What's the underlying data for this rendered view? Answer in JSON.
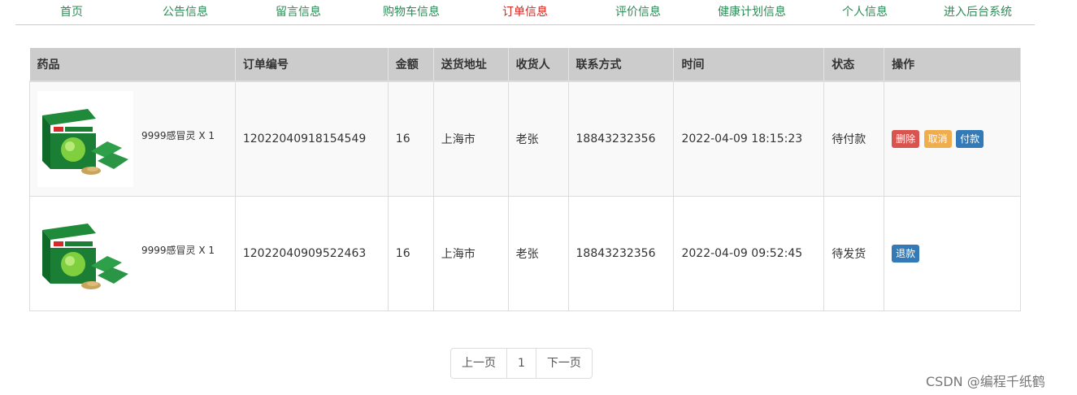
{
  "nav": {
    "items": [
      {
        "label": "首页"
      },
      {
        "label": "公告信息"
      },
      {
        "label": "留言信息"
      },
      {
        "label": "购物车信息"
      },
      {
        "label": "订单信息",
        "active": true
      },
      {
        "label": "评价信息"
      },
      {
        "label": "健康计划信息"
      },
      {
        "label": "个人信息"
      },
      {
        "label": "进入后台系统"
      }
    ],
    "color": "#2e8b57",
    "active_color": "#d9231d"
  },
  "table": {
    "headers": [
      "药品",
      "订单编号",
      "金额",
      "送货地址",
      "收货人",
      "联系方式",
      "时间",
      "状态",
      "操作"
    ],
    "rows": [
      {
        "drug": "9999感冒灵 X 1",
        "image_icon": "medicine-box-image",
        "order_no": "12022040918154549",
        "amount": "16",
        "address": "上海市",
        "receiver": "老张",
        "phone": "18843232356",
        "time": "2022-04-09 18:15:23",
        "status": "待付款",
        "actions": [
          "删除",
          "取消",
          "付款"
        ]
      },
      {
        "drug": "9999感冒灵 X 1",
        "image_icon": "medicine-box-image",
        "order_no": "12022040909522463",
        "amount": "16",
        "address": "上海市",
        "receiver": "老张",
        "phone": "18843232356",
        "time": "2022-04-09 09:52:45",
        "status": "待发货",
        "actions": [
          "退款"
        ]
      }
    ]
  },
  "pager": {
    "prev": "上一页",
    "page": "1",
    "next": "下一页"
  },
  "watermark": "CSDN @编程千纸鹤",
  "colors": {
    "danger": "#d9534f",
    "warning": "#f0ad4e",
    "primary": "#337ab7",
    "header_bg": "#cccccc"
  }
}
